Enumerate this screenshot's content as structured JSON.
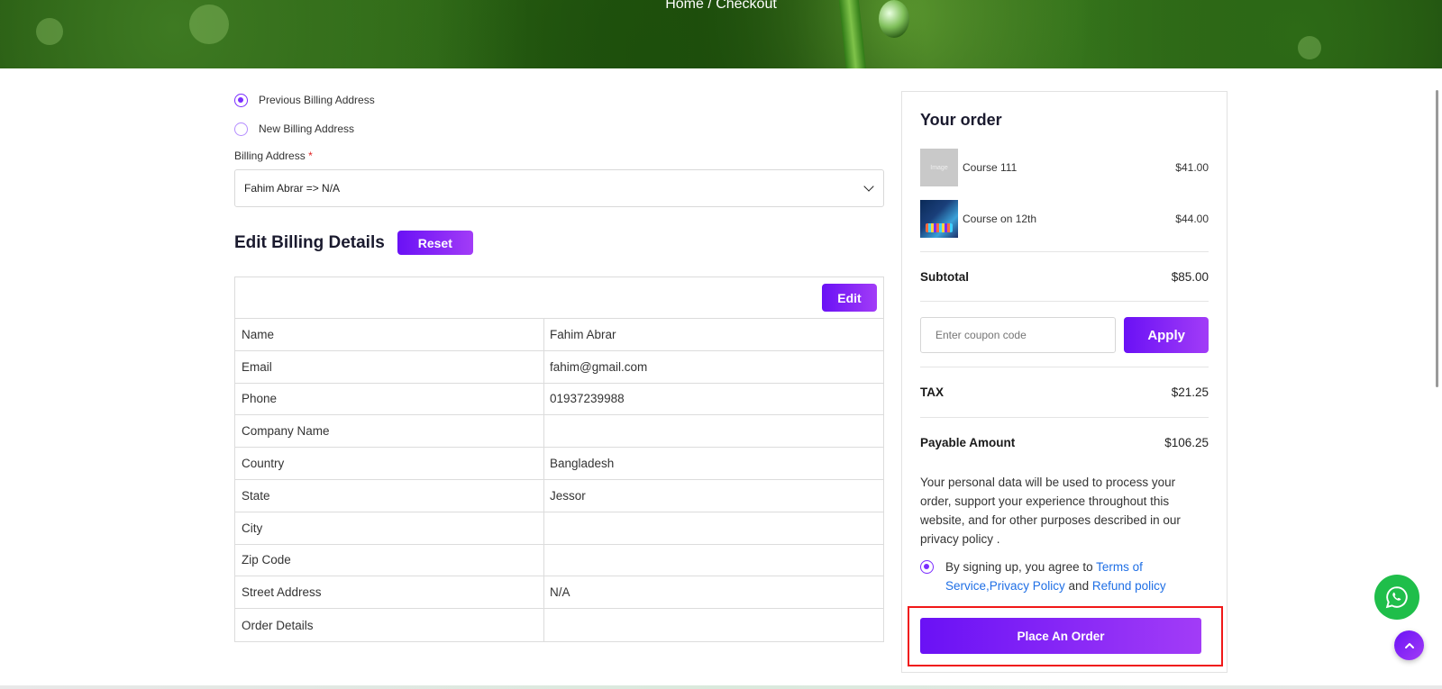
{
  "header": {
    "breadcrumb": "Home / Checkout"
  },
  "billing": {
    "options": [
      {
        "label": "Previous Billing Address",
        "checked": true
      },
      {
        "label": "New Billing Address",
        "checked": false
      }
    ],
    "address_label": "Billing Address",
    "required_mark": "*",
    "address_value": "Fahim Abrar => N/A",
    "edit_title": "Edit Billing Details",
    "reset_label": "Reset",
    "edit_label": "Edit",
    "rows": [
      {
        "key": "Name",
        "value": "Fahim Abrar"
      },
      {
        "key": "Email",
        "value": "fahim@gmail.com"
      },
      {
        "key": "Phone",
        "value": "01937239988"
      },
      {
        "key": "Company Name",
        "value": ""
      },
      {
        "key": "Country",
        "value": "Bangladesh"
      },
      {
        "key": "State",
        "value": "Jessor"
      },
      {
        "key": "City",
        "value": ""
      },
      {
        "key": "Zip Code",
        "value": ""
      },
      {
        "key": "Street Address",
        "value": "N/A"
      },
      {
        "key": "Order Details",
        "value": ""
      }
    ]
  },
  "order": {
    "title": "Your order",
    "items": [
      {
        "thumb_text": "Image",
        "name": "Course 111",
        "price": "$41.00"
      },
      {
        "thumb_text": "",
        "name": "Course on 12th",
        "price": "$44.00"
      }
    ],
    "subtotal_label": "Subtotal",
    "subtotal_value": "$85.00",
    "coupon_placeholder": "Enter coupon code",
    "apply_label": "Apply",
    "tax_label": "TAX",
    "tax_value": "$21.25",
    "payable_label": "Payable Amount",
    "payable_value": "$106.25",
    "policy_text": "Your personal data will be used to process your order, support your experience throughout this website, and for other purposes described in our privacy policy .",
    "agree_prefix": "By signing up, you agree to ",
    "terms_link": "Terms of Service",
    "privacy_link": ",Privacy Policy",
    "agree_and": " and ",
    "refund_link": "Refund policy",
    "place_order_label": "Place An Order"
  },
  "colors": {
    "accent": "#7a2cff",
    "highlight": "#f01818",
    "whatsapp": "#1fbe4a"
  },
  "icons": [
    "chevron-down-icon",
    "whatsapp-icon",
    "arrow-up-icon"
  ]
}
